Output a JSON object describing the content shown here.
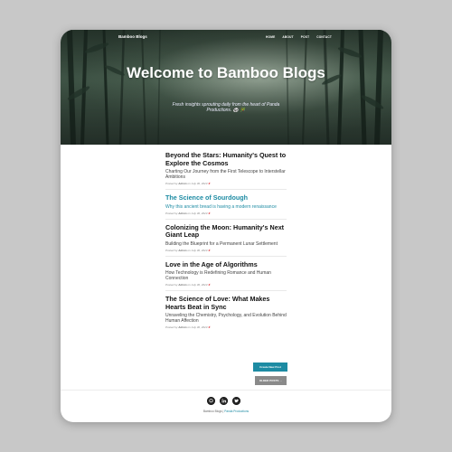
{
  "header": {
    "brand": "Bamboo Blogs",
    "nav": [
      "HOME",
      "ABOUT",
      "POST",
      "CONTACT"
    ],
    "title": "Welcome to Bamboo Blogs",
    "subtitle": "Fresh insights sprouting daily from the heart of Panda Productions. 🐼 🎋"
  },
  "posts": [
    {
      "title": "Beyond the Stars: Humanity's Quest to Explore the Cosmos",
      "subtitle": "Charting Our Journey from the First Telescope to Interstellar Ambitions",
      "meta_prefix": "Posted by",
      "author": "Admin",
      "meta_date": "on July 30, 2023",
      "highlight": false
    },
    {
      "title": "The Science of Sourdough",
      "subtitle": "Why this ancient bread is having a modern renaissance",
      "meta_prefix": "Posted by",
      "author": "Admin",
      "meta_date": "on July 30, 2023",
      "highlight": true
    },
    {
      "title": "Colonizing the Moon: Humanity's Next Giant Leap",
      "subtitle": "Building the Blueprint for a Permanent Lunar Settlement",
      "meta_prefix": "Posted by",
      "author": "Admin",
      "meta_date": "on July 30, 2023",
      "highlight": false
    },
    {
      "title": "Love in the Age of Algorithms",
      "subtitle": "How Technology is Redefining Romance and Human Connection",
      "meta_prefix": "Posted by",
      "author": "Admin",
      "meta_date": "on July 30, 2023",
      "highlight": false
    },
    {
      "title": "The Science of Love: What Makes Hearts Beat in Sync",
      "subtitle": "Unraveling the Chemistry, Psychology, and Evolution Behind Human Affection",
      "meta_prefix": "Posted by",
      "author": "Admin",
      "meta_date": "on July 30, 2023",
      "highlight": false
    }
  ],
  "buttons": {
    "create": "Create New Post",
    "older": "OLDER POSTS →"
  },
  "footer": {
    "socials": [
      "github-icon",
      "linkedin-icon",
      "twitter-icon"
    ],
    "copyright_prefix": "Bamboo Blogs |",
    "copyright_link": "Panda Productions"
  },
  "colors": {
    "accent": "#1d8ba3",
    "delete": "#e0383e",
    "older_button": "#8a8a8a"
  }
}
